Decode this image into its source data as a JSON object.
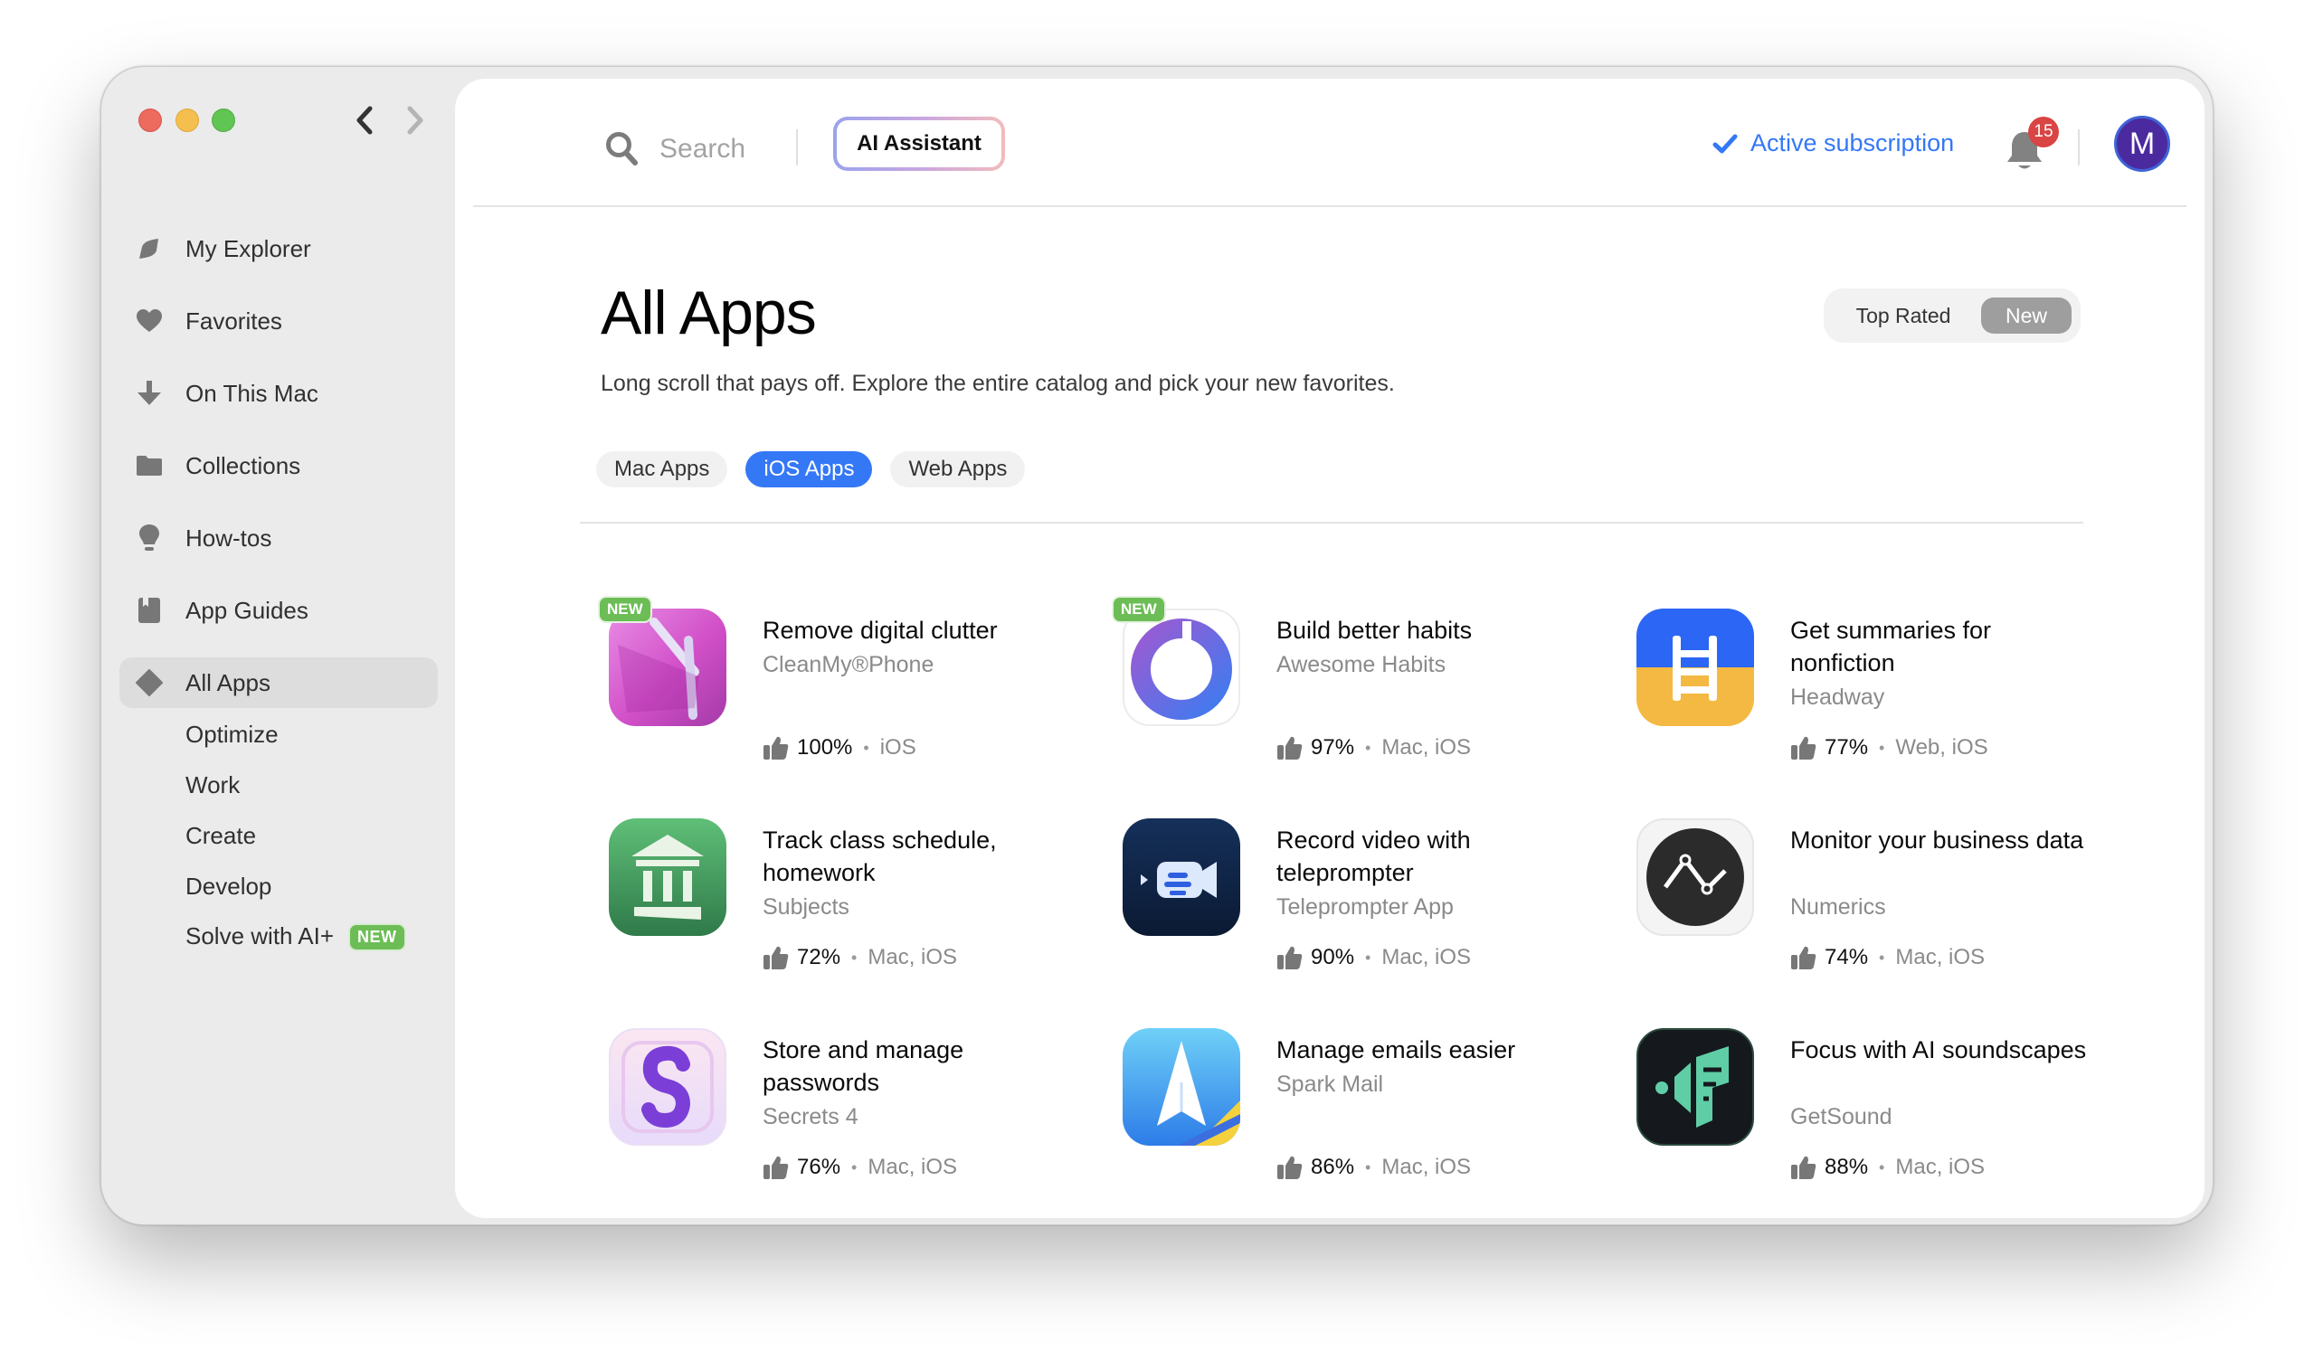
{
  "window": {
    "nav": {
      "back_icon": "chevron-left-icon",
      "forward_icon": "chevron-right-icon"
    }
  },
  "sidebar": {
    "items": [
      {
        "label": "My Explorer",
        "icon": "leaf-icon"
      },
      {
        "label": "Favorites",
        "icon": "heart-icon"
      },
      {
        "label": "On This Mac",
        "icon": "download-arrow-icon"
      },
      {
        "label": "Collections",
        "icon": "folder-icon"
      },
      {
        "label": "How-tos",
        "icon": "lightbulb-icon"
      },
      {
        "label": "App Guides",
        "icon": "book-icon"
      },
      {
        "label": "All Apps",
        "icon": "diamond-icon",
        "active": true
      }
    ],
    "subitems": [
      {
        "label": "Optimize"
      },
      {
        "label": "Work"
      },
      {
        "label": "Create"
      },
      {
        "label": "Develop"
      },
      {
        "label": "Solve with AI+",
        "badge": "NEW"
      }
    ]
  },
  "header": {
    "search_placeholder": "Search",
    "ai_button": "AI Assistant",
    "subscription": "Active subscription",
    "notification_count": "15",
    "avatar_initial": "M"
  },
  "colors": {
    "accent": "#3478f6",
    "new_badge": "#6cbd56",
    "notification": "#d94444",
    "avatar": "#4b2aa0"
  },
  "main": {
    "title": "All Apps",
    "description": "Long scroll that pays off. Explore the entire catalog and pick your new favorites.",
    "sort": {
      "options": [
        "Top Rated",
        "New"
      ],
      "selected": "New"
    },
    "tabs": [
      {
        "label": "Mac Apps",
        "active": false
      },
      {
        "label": "iOS Apps",
        "active": true
      },
      {
        "label": "Web Apps",
        "active": false
      }
    ],
    "apps": [
      {
        "title": "Remove digital clutter",
        "developer": "CleanMy®Phone",
        "rating": "100%",
        "platforms": "iOS",
        "new": "NEW"
      },
      {
        "title": "Build better habits",
        "developer": "Awesome Habits",
        "rating": "97%",
        "platforms": "Mac, iOS",
        "new": "NEW"
      },
      {
        "title": "Get summaries for nonfiction",
        "developer": "Headway",
        "rating": "77%",
        "platforms": "Web, iOS"
      },
      {
        "title": "Track class schedule, homework",
        "developer": "Subjects",
        "rating": "72%",
        "platforms": "Mac, iOS"
      },
      {
        "title": "Record video with teleprompter",
        "developer": "Teleprompter App",
        "rating": "90%",
        "platforms": "Mac, iOS"
      },
      {
        "title": "Monitor your business data",
        "developer": "Numerics",
        "rating": "74%",
        "platforms": "Mac, iOS"
      },
      {
        "title": "Store and manage passwords",
        "developer": "Secrets 4",
        "rating": "76%",
        "platforms": "Mac, iOS"
      },
      {
        "title": "Manage emails easier",
        "developer": "Spark Mail",
        "rating": "86%",
        "platforms": "Mac, iOS"
      },
      {
        "title": "Focus with AI soundscapes",
        "developer": "GetSound",
        "rating": "88%",
        "platforms": "Mac, iOS"
      }
    ]
  }
}
